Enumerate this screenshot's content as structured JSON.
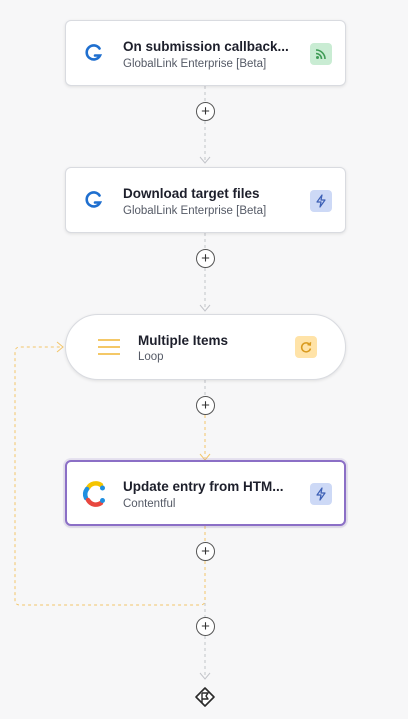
{
  "nodes": [
    {
      "title": "On submission callback...",
      "subtitle": "GlobalLink Enterprise [Beta]",
      "app_icon": "globallink-icon",
      "trigger_icon": "webhook-icon"
    },
    {
      "title": "Download target files",
      "subtitle": "GlobalLink Enterprise [Beta]",
      "app_icon": "globallink-icon",
      "trigger_icon": "bolt-icon"
    },
    {
      "title": "Multiple Items",
      "subtitle": "Loop",
      "app_icon": "menu-lines-icon",
      "trigger_icon": "loop-icon"
    },
    {
      "title": "Update entry from HTM...",
      "subtitle": "Contentful",
      "app_icon": "contentful-icon",
      "trigger_icon": "bolt-icon"
    }
  ],
  "add_step_buttons": [
    "+",
    "+",
    "+",
    "+",
    "+"
  ],
  "end_icon": "end-flag-icon",
  "colors": {
    "selected_border": "#8b6fc6",
    "loop_line": "#f3c66a",
    "connector": "#c2c4c9",
    "webhook_badge": "#c9ecd3",
    "bolt_badge": "#cdd9f6",
    "loop_badge": "#ffe3a8"
  }
}
